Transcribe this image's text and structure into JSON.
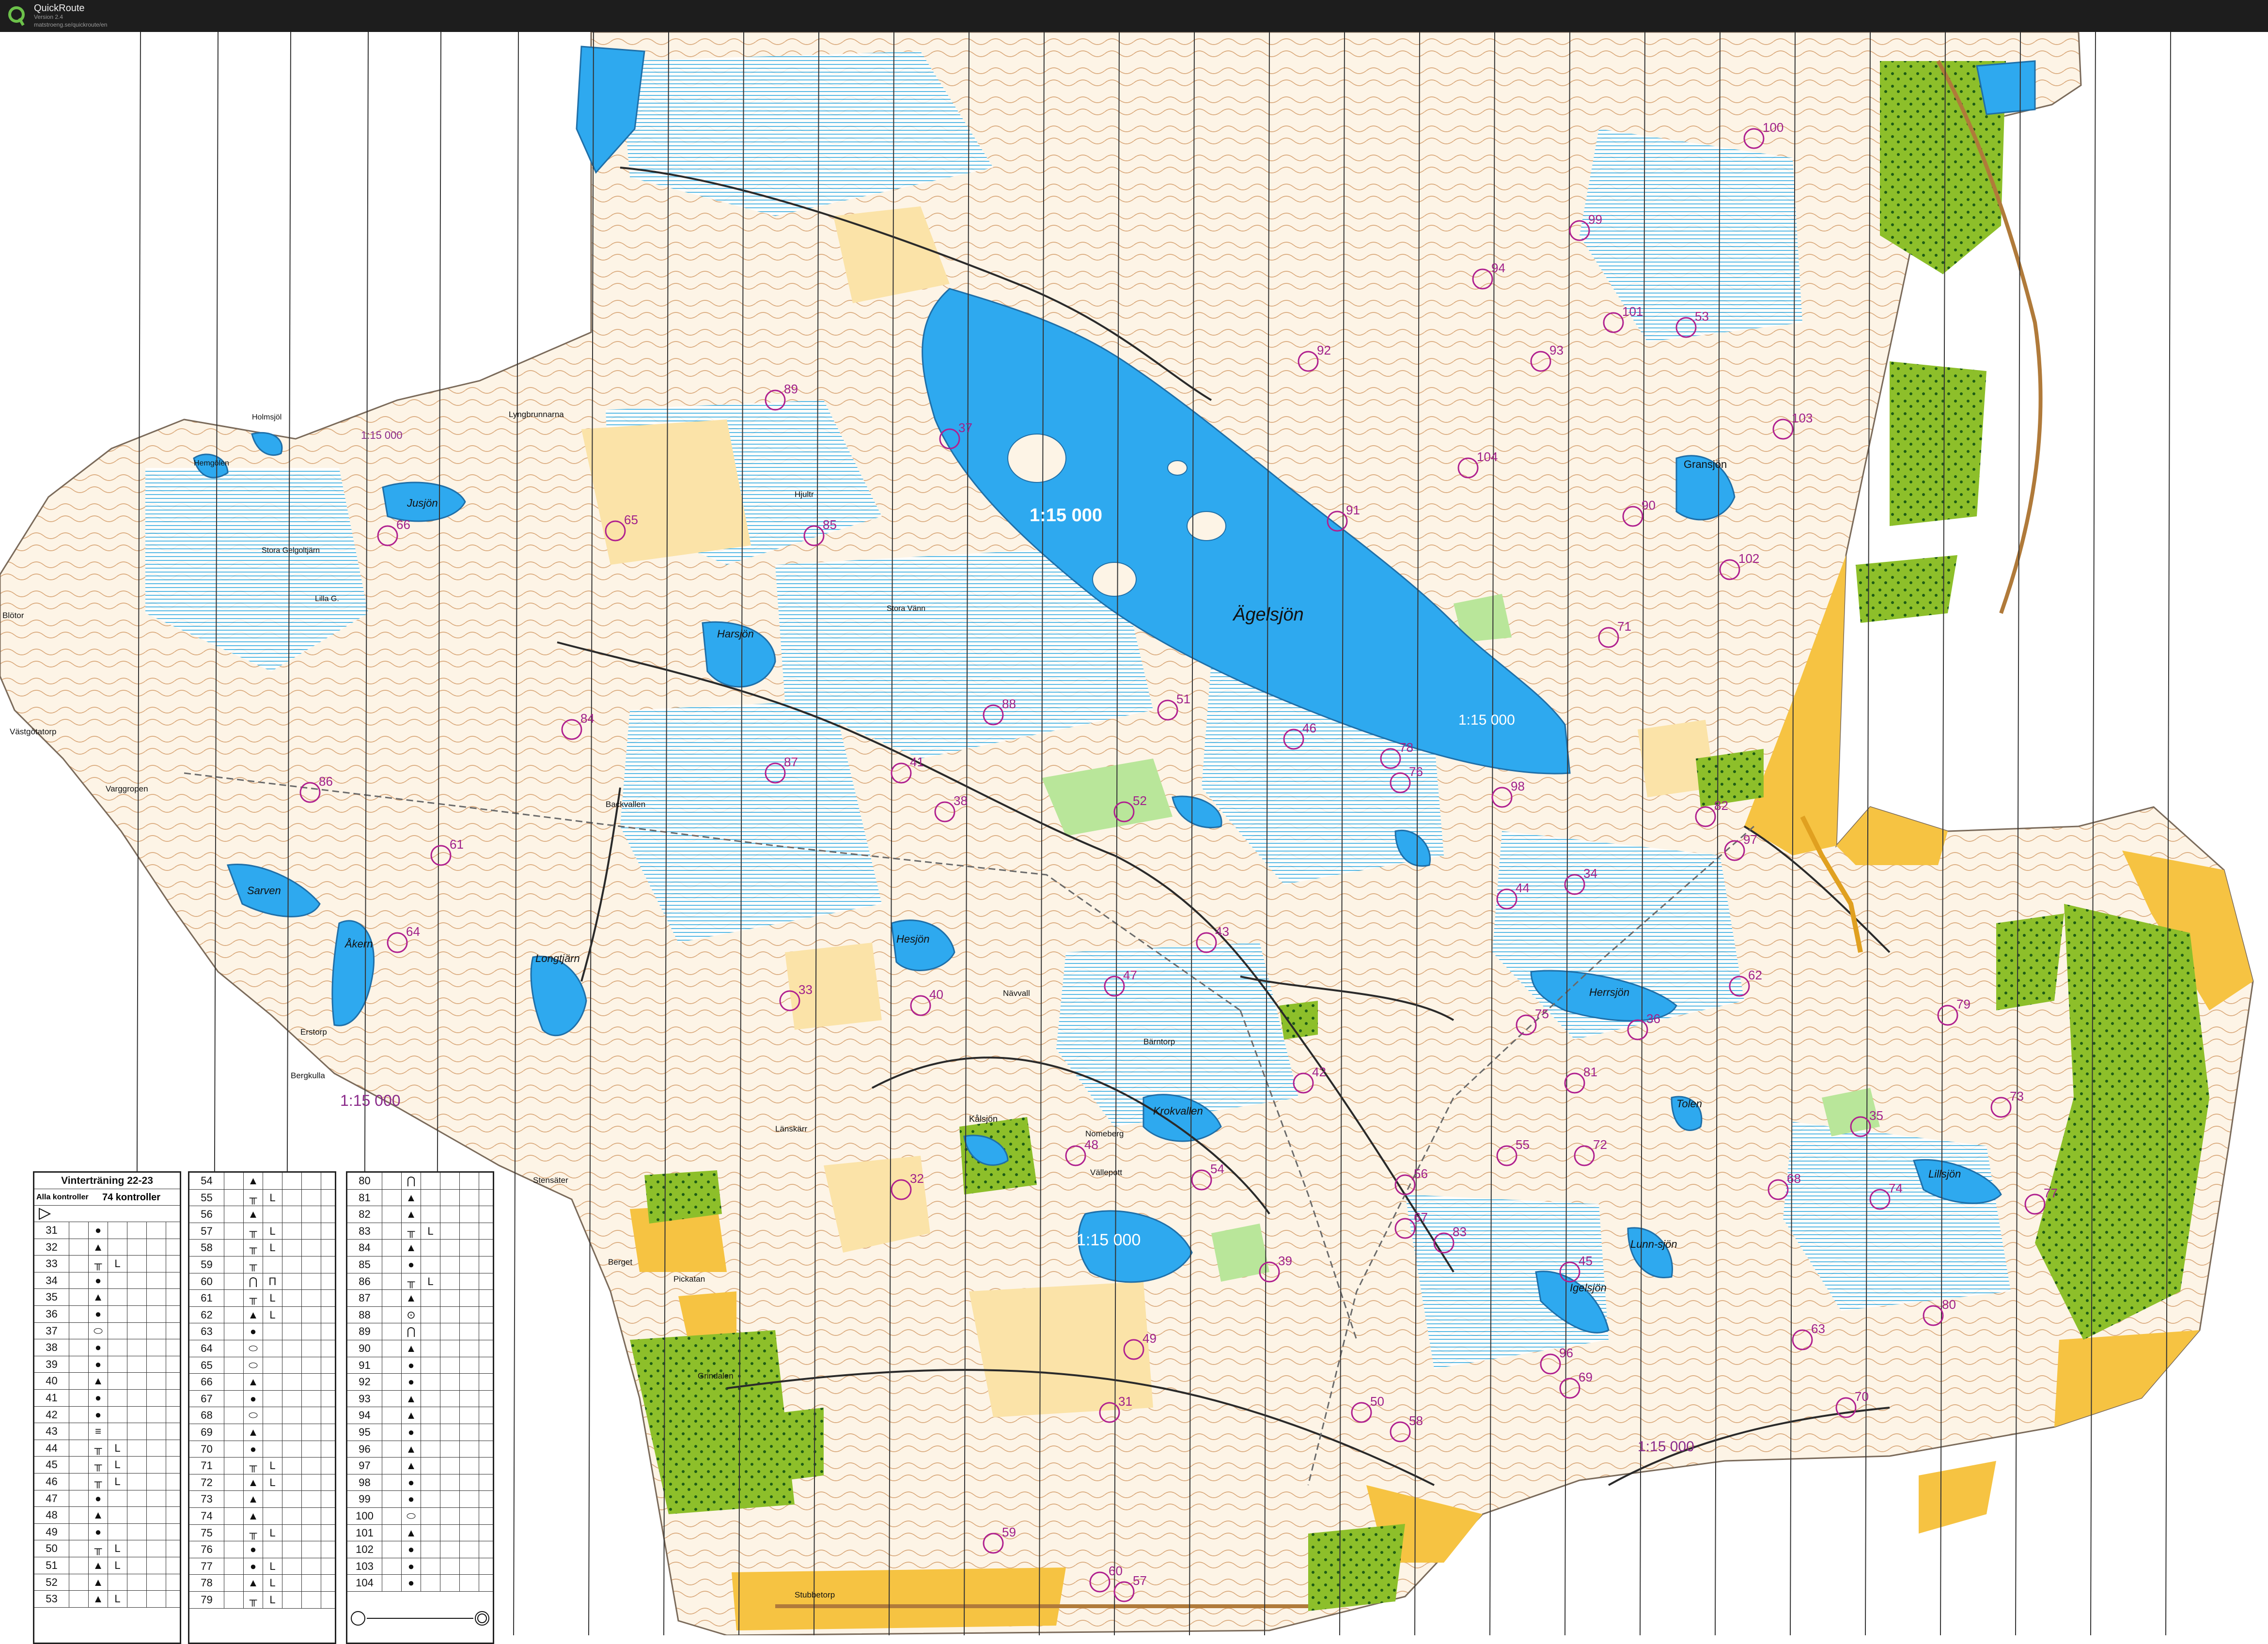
{
  "app": {
    "name": "QuickRoute",
    "version": "Version 2.4",
    "url": "matstroeng.se/quickroute/en"
  },
  "map": {
    "scale_labels": [
      "1:15 000",
      "1:15 000",
      "1:15 000",
      "1:15 000",
      "1:15 000",
      "1:15 000"
    ],
    "lakes": [
      "Ägelsjön",
      "Gransjön",
      "Jusjön",
      "Harsjön",
      "Sarven",
      "Åkern",
      "Longtjärn",
      "Hesjön",
      "Herrsjön",
      "Tolen",
      "Lillsjön",
      "Lunn-sjön",
      "Igelsjön",
      "Krokvallen",
      "Kålsjön",
      "Stora Gelgoltjärn",
      "Lilla G.",
      "Stora Vänn",
      "Hemgölen",
      "Holmsjöl"
    ],
    "places": [
      "Västgötatorp",
      "Varggropen",
      "Erstorp",
      "Bergkulla",
      "Stensäter",
      "Berget",
      "Pickatan",
      "Grindalen",
      "Stubbetorp",
      "Bärntorp",
      "Nomeberg",
      "Vällepott",
      "Länskärr",
      "Backvallen",
      "Nävvall",
      "Lyngbrunnarna",
      "Hjultr",
      "Blötor"
    ],
    "controls": [
      "31",
      "32",
      "33",
      "34",
      "35",
      "36",
      "37",
      "38",
      "39",
      "40",
      "41",
      "42",
      "43",
      "44",
      "45",
      "46",
      "47",
      "48",
      "49",
      "50",
      "51",
      "52",
      "53",
      "54",
      "55",
      "56",
      "57",
      "58",
      "59",
      "60",
      "61",
      "62",
      "63",
      "64",
      "65",
      "66",
      "67",
      "68",
      "69",
      "70",
      "71",
      "72",
      "73",
      "74",
      "75",
      "76",
      "77",
      "78",
      "79",
      "80",
      "81",
      "82",
      "83",
      "84",
      "85",
      "86",
      "87",
      "88",
      "89",
      "90",
      "91",
      "92",
      "93",
      "94",
      "95",
      "96",
      "97",
      "98",
      "99",
      "100",
      "101",
      "102",
      "103",
      "104"
    ]
  },
  "legend": {
    "title": "Vinterträning 22-23",
    "subtitle_left": "Alla kontroller",
    "subtitle_right": "74 kontroller",
    "col1": [
      {
        "n": "31",
        "s": "●",
        "e": ""
      },
      {
        "n": "32",
        "s": "▲",
        "e": ""
      },
      {
        "n": "33",
        "s": "╥",
        "e": "L"
      },
      {
        "n": "34",
        "s": "●",
        "e": ""
      },
      {
        "n": "35",
        "s": "▲",
        "e": ""
      },
      {
        "n": "36",
        "s": "●",
        "e": ""
      },
      {
        "n": "37",
        "s": "⬭",
        "e": ""
      },
      {
        "n": "38",
        "s": "●",
        "e": ""
      },
      {
        "n": "39",
        "s": "●",
        "e": ""
      },
      {
        "n": "40",
        "s": "▲",
        "e": ""
      },
      {
        "n": "41",
        "s": "●",
        "e": ""
      },
      {
        "n": "42",
        "s": "●",
        "e": ""
      },
      {
        "n": "43",
        "s": "≡",
        "e": ""
      },
      {
        "n": "44",
        "s": "╥",
        "e": "L"
      },
      {
        "n": "45",
        "s": "╥",
        "e": "L"
      },
      {
        "n": "46",
        "s": "╥",
        "e": "L"
      },
      {
        "n": "47",
        "s": "●",
        "e": ""
      },
      {
        "n": "48",
        "s": "▲",
        "e": ""
      },
      {
        "n": "49",
        "s": "●",
        "e": ""
      },
      {
        "n": "50",
        "s": "╥",
        "e": "L"
      },
      {
        "n": "51",
        "s": "▲",
        "e": "L"
      },
      {
        "n": "52",
        "s": "▲",
        "e": ""
      },
      {
        "n": "53",
        "s": "▲",
        "e": "L"
      }
    ],
    "col2": [
      {
        "n": "54",
        "s": "▲",
        "e": ""
      },
      {
        "n": "55",
        "s": "╥",
        "e": "L"
      },
      {
        "n": "56",
        "s": "▲",
        "e": ""
      },
      {
        "n": "57",
        "s": "╥",
        "e": "L"
      },
      {
        "n": "58",
        "s": "╥",
        "e": "L"
      },
      {
        "n": "59",
        "s": "╥",
        "e": ""
      },
      {
        "n": "60",
        "s": "⋂",
        "e": "Π"
      },
      {
        "n": "61",
        "s": "╥",
        "e": "L"
      },
      {
        "n": "62",
        "s": "▲",
        "e": "L"
      },
      {
        "n": "63",
        "s": "●",
        "e": ""
      },
      {
        "n": "64",
        "s": "⬭",
        "e": ""
      },
      {
        "n": "65",
        "s": "⬭",
        "e": ""
      },
      {
        "n": "66",
        "s": "▲",
        "e": ""
      },
      {
        "n": "67",
        "s": "●",
        "e": ""
      },
      {
        "n": "68",
        "s": "⬭",
        "e": ""
      },
      {
        "n": "69",
        "s": "▲",
        "e": ""
      },
      {
        "n": "70",
        "s": "●",
        "e": ""
      },
      {
        "n": "71",
        "s": "╥",
        "e": "L"
      },
      {
        "n": "72",
        "s": "▲",
        "e": "L"
      },
      {
        "n": "73",
        "s": "▲",
        "e": ""
      },
      {
        "n": "74",
        "s": "▲",
        "e": ""
      },
      {
        "n": "75",
        "s": "╥",
        "e": "L"
      },
      {
        "n": "76",
        "s": "●",
        "e": ""
      },
      {
        "n": "77",
        "s": "●",
        "e": "L"
      },
      {
        "n": "78",
        "s": "▲",
        "e": "L"
      },
      {
        "n": "79",
        "s": "╥",
        "e": "L"
      }
    ],
    "col3": [
      {
        "n": "80",
        "s": "⋂",
        "e": ""
      },
      {
        "n": "81",
        "s": "▲",
        "e": ""
      },
      {
        "n": "82",
        "s": "▲",
        "e": ""
      },
      {
        "n": "83",
        "s": "╥",
        "e": "L"
      },
      {
        "n": "84",
        "s": "▲",
        "e": ""
      },
      {
        "n": "85",
        "s": "●",
        "e": ""
      },
      {
        "n": "86",
        "s": "╥",
        "e": "L"
      },
      {
        "n": "87",
        "s": "▲",
        "e": ""
      },
      {
        "n": "88",
        "s": "⊙",
        "e": ""
      },
      {
        "n": "89",
        "s": "⋂",
        "e": ""
      },
      {
        "n": "90",
        "s": "▲",
        "e": ""
      },
      {
        "n": "91",
        "s": "●",
        "e": ""
      },
      {
        "n": "92",
        "s": "●",
        "e": ""
      },
      {
        "n": "93",
        "s": "▲",
        "e": ""
      },
      {
        "n": "94",
        "s": "▲",
        "e": ""
      },
      {
        "n": "95",
        "s": "●",
        "e": ""
      },
      {
        "n": "96",
        "s": "▲",
        "e": ""
      },
      {
        "n": "97",
        "s": "▲",
        "e": ""
      },
      {
        "n": "98",
        "s": "●",
        "e": ""
      },
      {
        "n": "99",
        "s": "●",
        "e": ""
      },
      {
        "n": "100",
        "s": "⬭",
        "e": ""
      },
      {
        "n": "101",
        "s": "▲",
        "e": ""
      },
      {
        "n": "102",
        "s": "●",
        "e": ""
      },
      {
        "n": "103",
        "s": "●",
        "e": ""
      },
      {
        "n": "104",
        "s": "●",
        "e": ""
      }
    ]
  }
}
